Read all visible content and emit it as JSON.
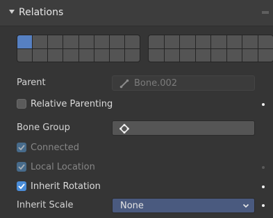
{
  "panel": {
    "title": "Relations"
  },
  "layers": {
    "group1_active": [
      0
    ],
    "group2_active": []
  },
  "parent": {
    "label": "Parent",
    "value": "Bone.002"
  },
  "relative_parenting": {
    "label": "Relative Parenting",
    "checked": false
  },
  "bone_group": {
    "label": "Bone Group",
    "value": ""
  },
  "connected": {
    "label": "Connected",
    "checked": true,
    "enabled": false
  },
  "local_location": {
    "label": "Local Location",
    "checked": true,
    "enabled": false
  },
  "inherit_rotation": {
    "label": "Inherit Rotation",
    "checked": true,
    "enabled": true
  },
  "inherit_scale": {
    "label": "Inherit Scale",
    "value": "None"
  },
  "colors": {
    "accent": "#4a8dd9",
    "active_layer": "#5680c2",
    "select_bg": "#4a5a7f"
  },
  "icons": {
    "collapse": "triangle-down-icon",
    "bone": "bone-icon",
    "group": "group-icon",
    "chevron": "chevron-down-icon"
  }
}
